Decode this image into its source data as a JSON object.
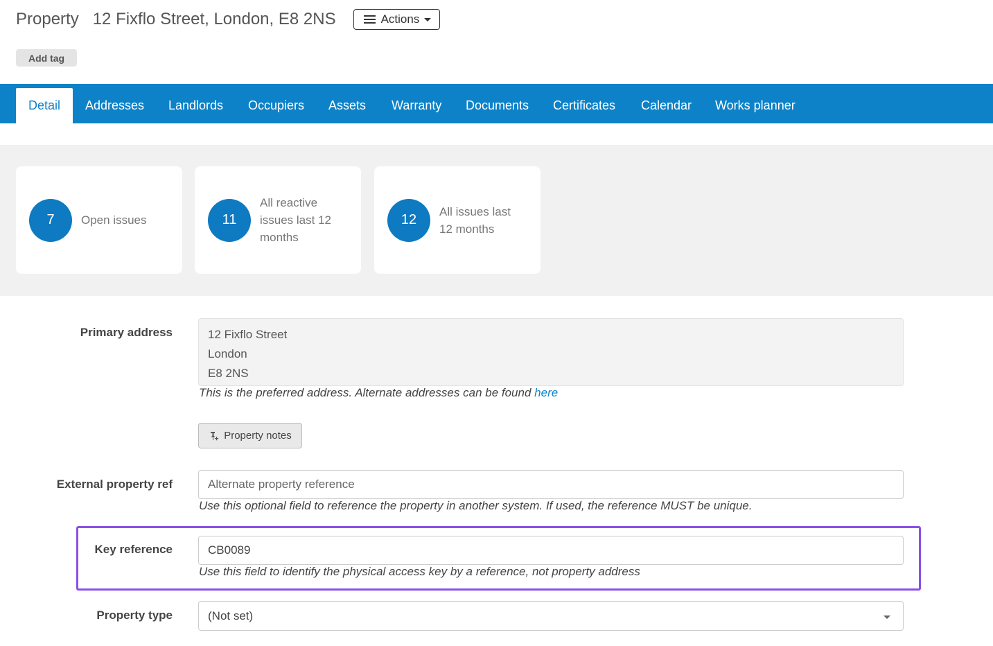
{
  "header": {
    "kind": "Property",
    "address": "12 Fixflo Street, London, E8 2NS",
    "actions_label": "Actions"
  },
  "add_tag_label": "Add tag",
  "tabs": [
    {
      "label": "Detail",
      "active": true
    },
    {
      "label": "Addresses"
    },
    {
      "label": "Landlords"
    },
    {
      "label": "Occupiers"
    },
    {
      "label": "Assets"
    },
    {
      "label": "Warranty"
    },
    {
      "label": "Documents"
    },
    {
      "label": "Certificates"
    },
    {
      "label": "Calendar"
    },
    {
      "label": "Works planner"
    }
  ],
  "stats": [
    {
      "count": "7",
      "label": "Open issues"
    },
    {
      "count": "11",
      "label": "All reactive issues last 12 months"
    },
    {
      "count": "12",
      "label": "All issues last 12 months"
    }
  ],
  "form": {
    "primary_address": {
      "label": "Primary address",
      "lines": [
        "12 Fixflo Street",
        "London",
        "E8 2NS"
      ],
      "help_text": "This is the preferred address. Alternate addresses can be found ",
      "help_link": "here"
    },
    "property_notes_label": "Property notes",
    "external_ref": {
      "label": "External property ref",
      "placeholder": "Alternate property reference",
      "help_text": "Use this optional field to reference the property in another system. If used, the reference MUST be unique."
    },
    "key_reference": {
      "label": "Key reference",
      "value": "CB0089",
      "help_text": "Use this field to identify the physical access key by a reference, not property address"
    },
    "property_type": {
      "label": "Property type",
      "selected": "(Not set)"
    }
  },
  "colors": {
    "brand_blue": "#0d82c8",
    "highlight_purple": "#8a4fe8"
  }
}
